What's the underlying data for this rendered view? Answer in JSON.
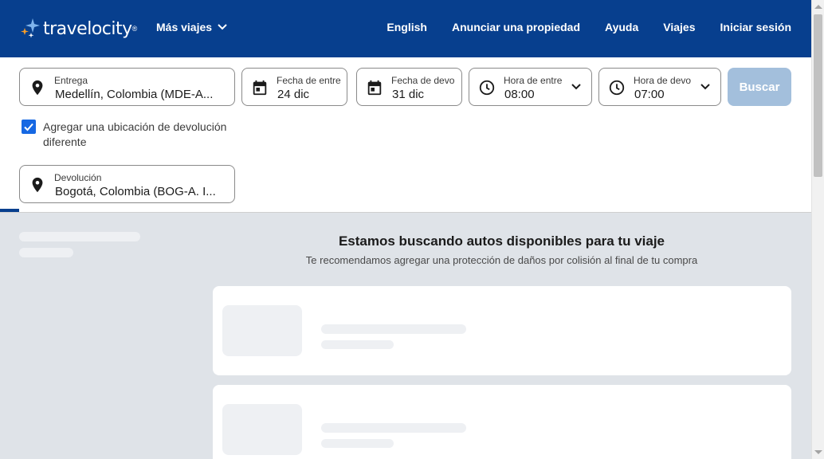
{
  "header": {
    "logo_text": "travelocity",
    "logo_mark": "®",
    "more_trips": "Más viajes",
    "nav": {
      "language": "English",
      "list_property": "Anunciar una propiedad",
      "help": "Ayuda",
      "trips": "Viajes",
      "sign_in": "Iniciar sesión"
    }
  },
  "search": {
    "pickup": {
      "label": "Entrega",
      "value": "Medellín, Colombia (MDE-A..."
    },
    "pickup_date": {
      "label": "Fecha de entre",
      "value": "24 dic"
    },
    "return_date": {
      "label": "Fecha de devo",
      "value": "31 dic"
    },
    "pickup_time": {
      "label": "Hora de entre",
      "value": "08:00"
    },
    "return_time": {
      "label": "Hora de devo",
      "value": "07:00"
    },
    "search_button": "Buscar",
    "different_return": {
      "checked": true,
      "label": "Agregar una ubicación de devolución diferente"
    },
    "dropoff": {
      "label": "Devolución",
      "value": "Bogotá, Colombia (BOG-A. I..."
    }
  },
  "results": {
    "title": "Estamos buscando autos disponibles para tu viaje",
    "subtitle": "Te recomendamos agregar una protección de daños por colisión al final de tu compra"
  },
  "colors": {
    "brand": "#073f8e",
    "search_button": "#a3bfdc",
    "checkbox": "#1668e3",
    "results_bg": "#dfe3e8"
  },
  "icons": [
    "location-pin-icon",
    "calendar-icon",
    "clock-icon",
    "chevron-down-icon",
    "checkmark-icon"
  ]
}
